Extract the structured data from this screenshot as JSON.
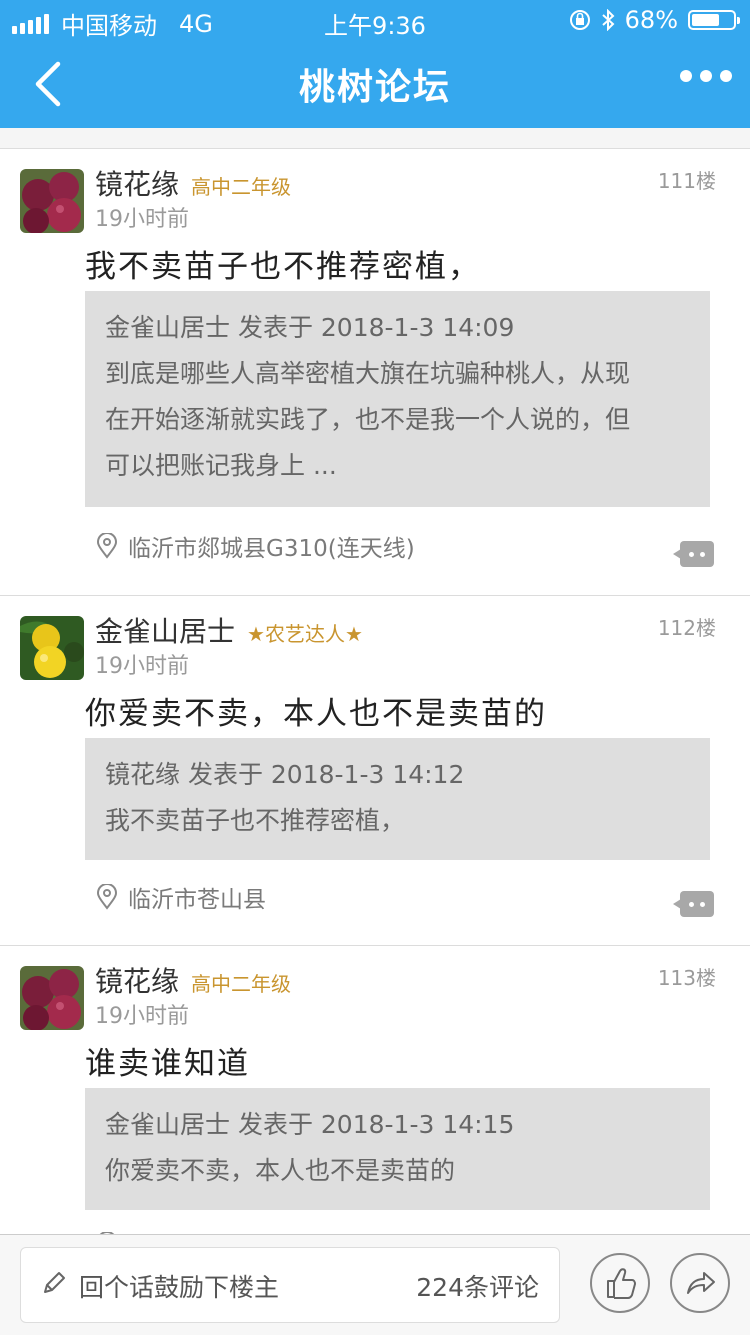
{
  "status_bar": {
    "carrier": "中国移动",
    "network": "4G",
    "time": "上午9:36",
    "battery": "68%",
    "battery_level": 0.68
  },
  "header": {
    "title": "桃树论坛"
  },
  "posts": [
    {
      "username": "镜花缘",
      "rank": "高中二年级",
      "time": "19小时前",
      "floor": "111楼",
      "content": "我不卖苗子也不推荐密植，",
      "quote": {
        "header": "金雀山居士 发表于 2018-1-3 14:09",
        "lines": [
          "到底是哪些人高举密植大旗在坑骗种桃人，从现",
          "在开始逐渐就实践了，也不是我一个人说的，但",
          "可以把账记我身上 ..."
        ]
      },
      "location": "临沂市郯城县G310(连天线)"
    },
    {
      "username": "金雀山居士",
      "rank": "★农艺达人★",
      "time": "19小时前",
      "floor": "112楼",
      "content": "你爱卖不卖，本人也不是卖苗的",
      "quote": {
        "header": "镜花缘 发表于 2018-1-3 14:12",
        "lines": [
          "我不卖苗子也不推荐密植，"
        ]
      },
      "location": "临沂市苍山县"
    },
    {
      "username": "镜花缘",
      "rank": "高中二年级",
      "time": "19小时前",
      "floor": "113楼",
      "content": "谁卖谁知道",
      "quote": {
        "header": "金雀山居士 发表于 2018-1-3 14:15",
        "lines": [
          "你爱卖不卖，本人也不是卖苗的"
        ]
      },
      "location": ""
    }
  ],
  "bottom_bar": {
    "placeholder": "回个话鼓励下楼主",
    "comment_count": "224条评论"
  },
  "colors": {
    "accent": "#35a8ee",
    "rank_gold": "#c9952f",
    "quote_bg": "#dedede"
  },
  "icons": [
    "back-icon",
    "more-icon",
    "location-icon",
    "reply-icon",
    "pen-icon",
    "thumbs-up-icon",
    "share-icon"
  ]
}
